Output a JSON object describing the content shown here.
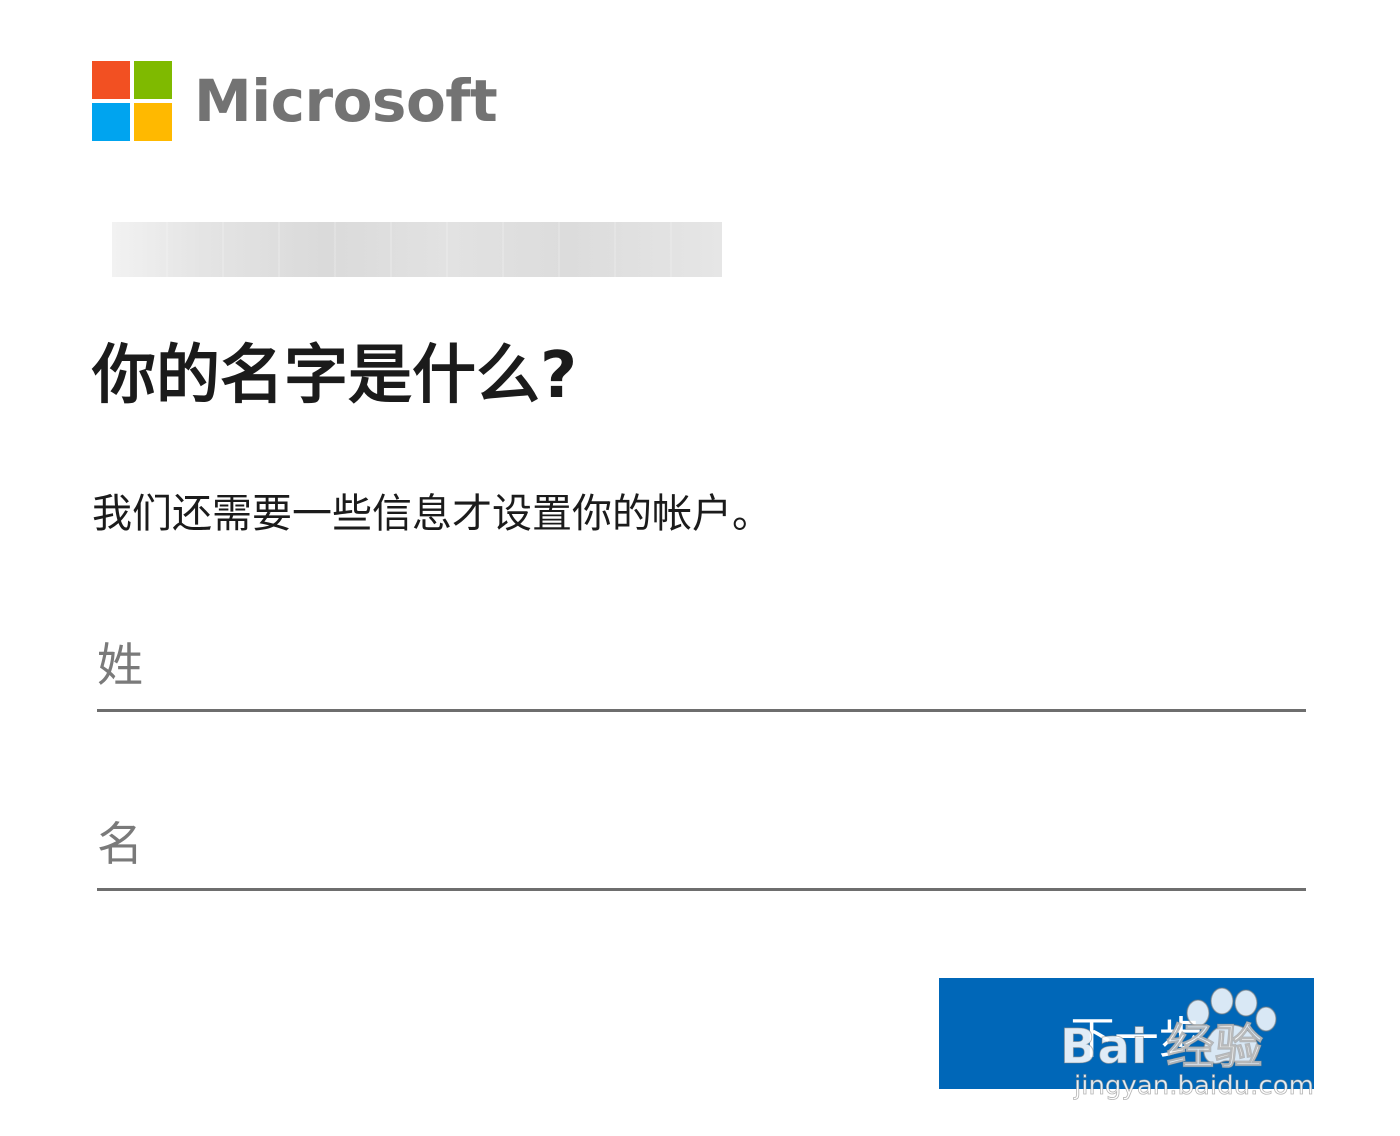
{
  "logo": {
    "wordmark": "Microsoft",
    "colors": [
      "#f25022",
      "#7fba00",
      "#00a4ef",
      "#ffb900"
    ],
    "icon": "microsoft-logo-icon"
  },
  "page": {
    "title": "你的名字是什么?",
    "subtitle": "我们还需要一些信息才设置你的帐户。"
  },
  "form": {
    "last_name_placeholder": "姓",
    "last_name_value": "",
    "first_name_placeholder": "名",
    "first_name_value": ""
  },
  "actions": {
    "next_label": "下一步"
  },
  "watermark": {
    "brand": "Bai  经验",
    "url": "jingyan.baidu.com",
    "icon": "baidu-paw-icon"
  },
  "colors": {
    "accent": "#0067b8",
    "text": "#1b1b1b",
    "logo_text": "#737373",
    "placeholder": "#7a7a7a"
  }
}
